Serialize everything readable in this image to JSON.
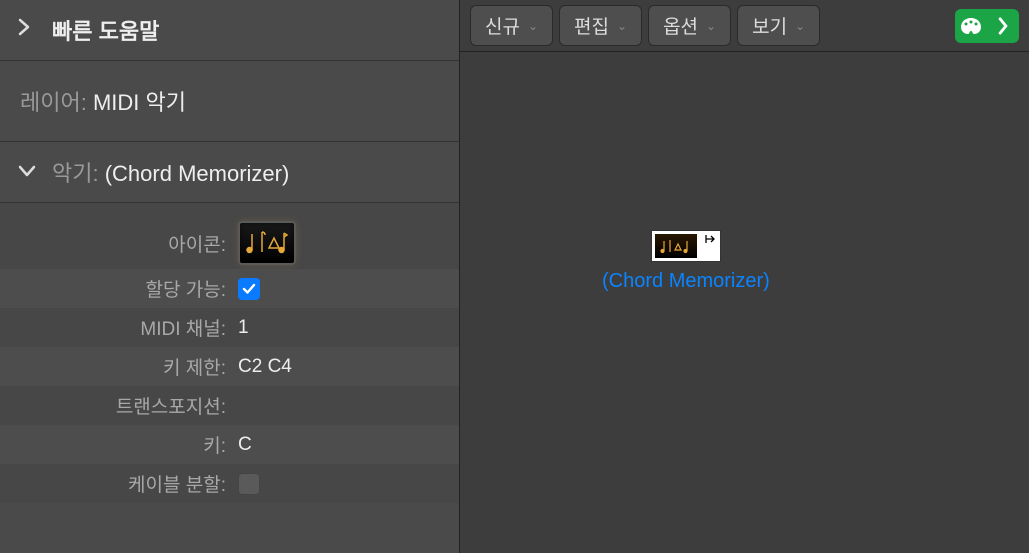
{
  "sidebar": {
    "quickHelp": "빠른 도움말",
    "layer": {
      "label": "레이어: ",
      "value": "MIDI 악기"
    },
    "instrument": {
      "label": "악기: ",
      "value": "(Chord Memorizer)"
    },
    "params": {
      "iconLabel": "아이콘:",
      "assignableLabel": "할당 가능:",
      "midiChannelLabel": "MIDI 채널:",
      "midiChannelValue": "1",
      "keyLimitLabel": "키 제한:",
      "keyLimitValue": "C2  C4",
      "transpositionLabel": "트랜스포지션:",
      "transpositionValue": "",
      "keyLabel": "키:",
      "keyValue": "C",
      "cableSplitLabel": "케이블 분할:"
    }
  },
  "toolbar": {
    "new": "신규",
    "edit": "편집",
    "option": "옵션",
    "view": "보기"
  },
  "canvas": {
    "nodeLabel": "(Chord Memorizer)"
  }
}
